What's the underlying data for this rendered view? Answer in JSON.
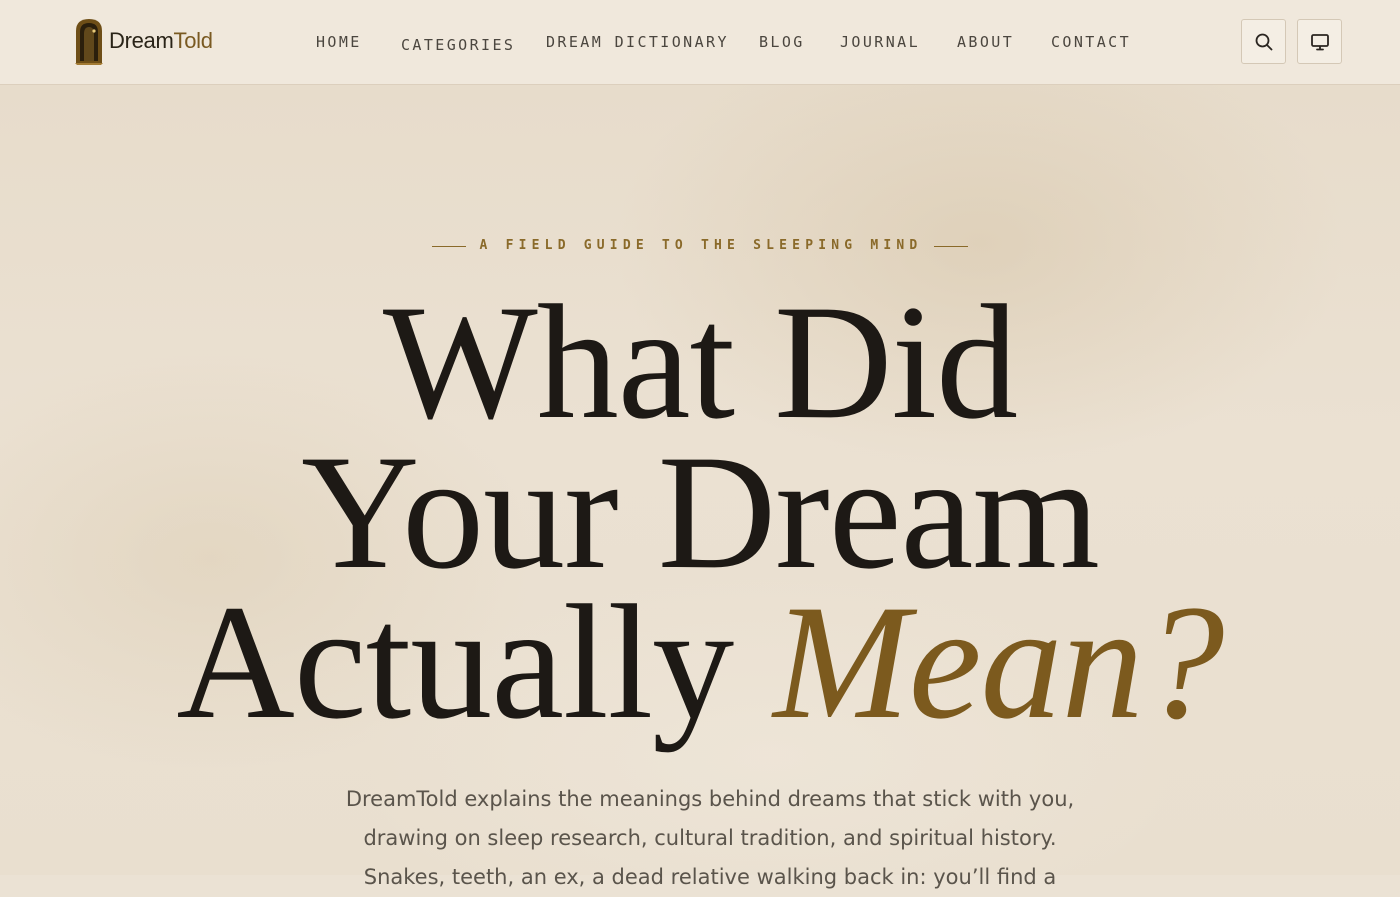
{
  "brand": {
    "name_part1": "Dream",
    "name_part2": "Told"
  },
  "nav": {
    "items": [
      {
        "label": "HOME"
      },
      {
        "label": "CATEGORIES"
      },
      {
        "label": "DREAM DICTIONARY"
      },
      {
        "label": "BLOG"
      },
      {
        "label": "JOURNAL"
      },
      {
        "label": "ABOUT"
      },
      {
        "label": "CONTACT"
      }
    ]
  },
  "header_actions": {
    "search_icon": "search-icon",
    "theme_icon": "monitor-icon"
  },
  "hero": {
    "eyebrow": "A FIELD GUIDE TO THE SLEEPING MIND",
    "headline_line1": "What Did",
    "headline_line2": "Your Dream",
    "headline_line3_plain": "Actually ",
    "headline_line3_accent": "Mean?",
    "lead_line1": "DreamTold explains the meanings behind dreams that stick with you,",
    "lead_line2": "drawing on sleep research, cultural tradition, and spiritual history.",
    "lead_line3": "Snakes, teeth, an ex, a dead relative walking back in: you’ll find a"
  },
  "colors": {
    "accent": "#7c5a1e",
    "text": "#1d1915",
    "background": "#ebe2d4"
  }
}
